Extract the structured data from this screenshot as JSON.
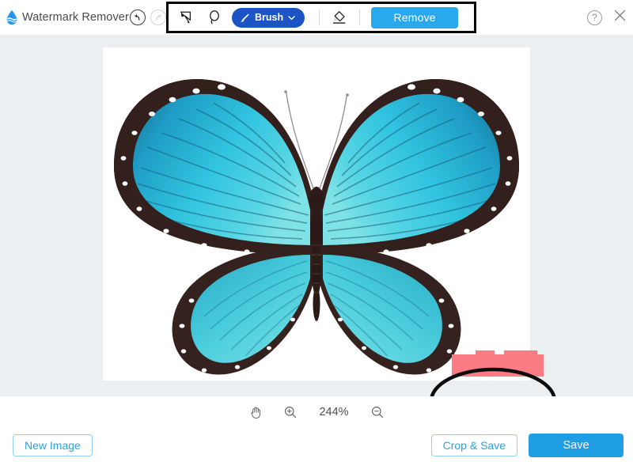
{
  "app": {
    "name": "Watermark Remover",
    "logo_icon": "water-drop-icon"
  },
  "header": {
    "undo_icon": "undo-arrow-icon",
    "redo_icon": "redo-arrow-icon",
    "help_icon": "question-mark-icon",
    "help_label": "?",
    "close_icon": "close-x-icon"
  },
  "toolbar": {
    "polygon_tool_icon": "polygon-lasso-icon",
    "lasso_tool_icon": "freehand-lasso-icon",
    "brush": {
      "icon": "brush-icon",
      "label": "Brush",
      "chevron_icon": "chevron-down-icon"
    },
    "eraser_icon": "eraser-icon",
    "remove_label": "Remove",
    "remove_color": "#29a8eb",
    "brush_pill_color": "#1b54c4",
    "annotation_frame_color": "#000000"
  },
  "canvas": {
    "image_subject": "blue morpho butterfly",
    "background_color": "#ffffff",
    "workarea_color": "#eceff1",
    "mask_color": "#fa7b83",
    "annotation_ellipse_color": "#000000"
  },
  "zoombar": {
    "pan_icon": "hand-pan-icon",
    "zoom_in_icon": "magnifier-plus-icon",
    "zoom_level": "244%",
    "zoom_out_icon": "magnifier-minus-icon"
  },
  "footer": {
    "new_image_label": "New Image",
    "crop_save_label": "Crop & Save",
    "save_label": "Save",
    "save_color": "#1e9fe3",
    "outline_color": "#8fd0ef"
  }
}
